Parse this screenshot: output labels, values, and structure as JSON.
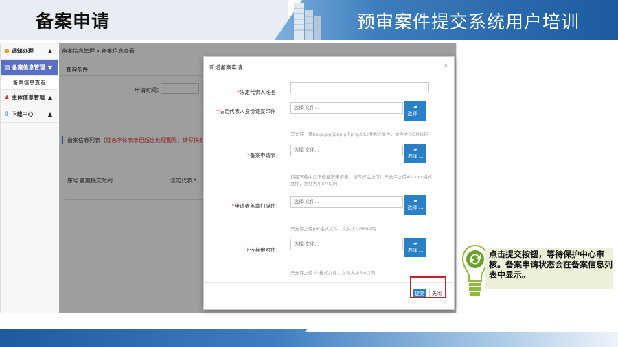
{
  "header": {
    "title": "备案申请",
    "subtitle": "预审案件提交系统用户培训"
  },
  "sidebar": {
    "items": [
      {
        "label": "通知办理",
        "chevron": "▲"
      },
      {
        "label": "备案信息管理",
        "chevron": "▼"
      },
      {
        "label": "主体信息管理",
        "chevron": "▲"
      },
      {
        "label": "下载中心",
        "chevron": "▲"
      }
    ],
    "subitem": "备案信息查看"
  },
  "main": {
    "breadcrumb": "备案信息管理 » 备案信息查看",
    "query_label": "查询条件",
    "date_label": "申请时间：",
    "list_title_prefix": "备案信息列表（",
    "list_title_red": "红色字体表示已超出处理期限，请尽快处理",
    "list_title_suffix": "）",
    "columns": [
      "序号",
      "备案提交时间",
      "法定代表人"
    ]
  },
  "modal": {
    "title": "新增备案申请",
    "close": "×",
    "fields": [
      {
        "label": "法定代表人姓名：",
        "required": true,
        "type": "text"
      },
      {
        "label": "法定代表人身份证复印件：",
        "required": true,
        "type": "file",
        "placeholder": "选择 文件...",
        "browse": "选择 ...",
        "hint": "只允许上传bmp,jpg,jpeg,gif,png,tif,tiff格式文件，文件大小5M以内"
      },
      {
        "label": "备案申请表：",
        "required": true,
        "type": "file",
        "placeholder": "选择 文件...",
        "browse": "选择 ...",
        "hint": "请在下载中心下载备案申请表，填写好后上传！只允许上传xls,xlsx格式文件，文件大小5M以内"
      },
      {
        "label": "申请表盖章扫描件：",
        "required": true,
        "type": "file",
        "placeholder": "选择 文件...",
        "browse": "选择 ...",
        "hint": "只允许上传pdf格式文件，文件大小5M以内"
      },
      {
        "label": "上传其他附件：",
        "required": false,
        "type": "file",
        "placeholder": "选择 文件...",
        "browse": "选择 ...",
        "hint": "只允许上传zip格式文件，文件大小5M以内"
      }
    ],
    "submit": "提交",
    "cancel": "关闭"
  },
  "callout": {
    "text": "点击提交按钮，等待保护中心审核。备案申请状态会在备案信息列表中显示。"
  },
  "colors": {
    "accent_blue": "#2a80c6",
    "sidebar_active": "#5a6fc3",
    "highlight_red": "#c0232a",
    "header_blue": "#1b5b9e"
  }
}
